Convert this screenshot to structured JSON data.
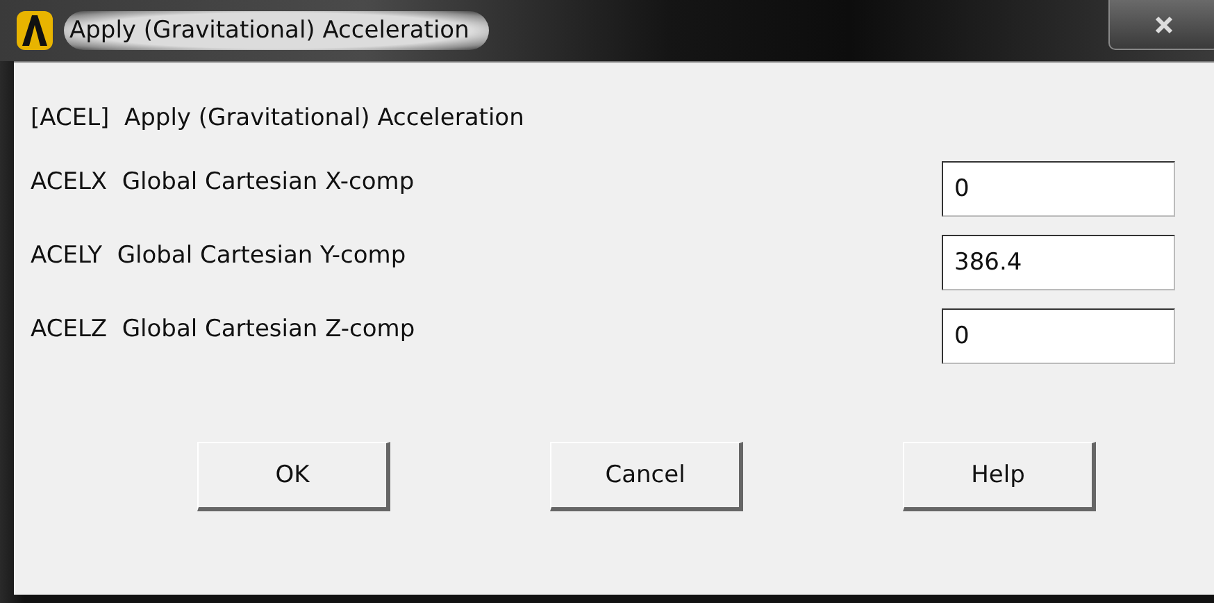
{
  "window": {
    "title": "Apply (Gravitational) Acceleration"
  },
  "heading": "[ACEL]  Apply (Gravitational) Acceleration",
  "fields": [
    {
      "label": "ACELX  Global Cartesian X-comp",
      "value": "0"
    },
    {
      "label": "ACELY  Global Cartesian Y-comp",
      "value": "386.4"
    },
    {
      "label": "ACELZ  Global Cartesian Z-comp",
      "value": "0"
    }
  ],
  "buttons": [
    "OK",
    "Cancel",
    "Help"
  ]
}
